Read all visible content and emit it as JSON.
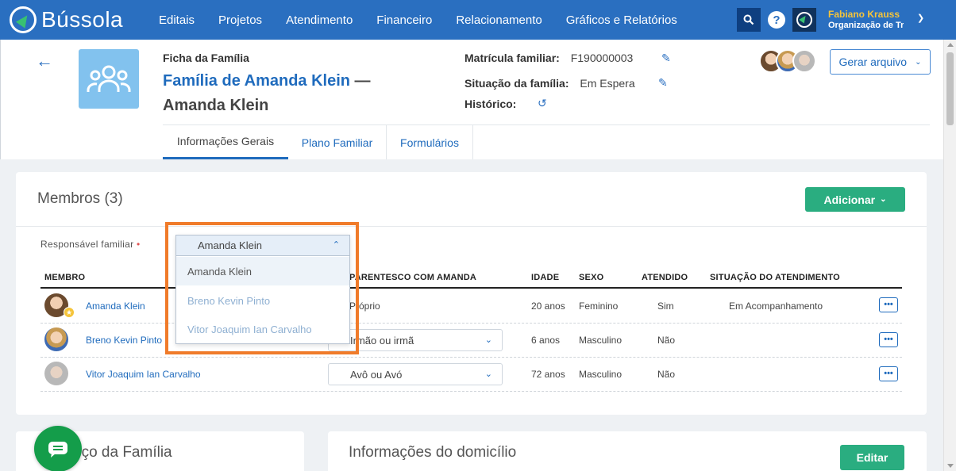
{
  "app": {
    "name": "Bússola"
  },
  "nav": {
    "items": [
      "Editais",
      "Projetos",
      "Atendimento",
      "Financeiro",
      "Relacionamento",
      "Gráficos e Relatórios"
    ]
  },
  "user": {
    "name": "Fabiano Krauss",
    "org": "Organização de Tre"
  },
  "header": {
    "ficha_label": "Ficha da Família",
    "title_link": "Família de Amanda Klein",
    "title_sep": " — ",
    "title_rest": "Amanda Klein",
    "matricula_label": "Matrícula familiar:",
    "matricula_value": "F190000003",
    "situacao_label": "Situação da família:",
    "situacao_value": "Em Espera",
    "historico_label": "Histórico:",
    "gerar_label": "Gerar arquivo"
  },
  "tabs": [
    "Informações Gerais",
    "Plano Familiar",
    "Formulários"
  ],
  "members": {
    "title": "Membros (3)",
    "add_label": "Adicionar",
    "responsavel_label": "Responsável familiar",
    "required_mark": "•",
    "columns": [
      "MEMBRO",
      "PARENTESCO COM AMANDA",
      "IDADE",
      "SEXO",
      "ATENDIDO",
      "SITUAÇÃO DO ATENDIMENTO"
    ],
    "rows": [
      {
        "name": "Amanda Klein",
        "relation": "Próprio",
        "age": "20 anos",
        "sex": "Feminino",
        "attended": "Sim",
        "status": "Em Acompanhamento"
      },
      {
        "name": "Breno Kevin Pinto",
        "relation": "Irmão ou irmã",
        "age": "6 anos",
        "sex": "Masculino",
        "attended": "Não",
        "status": ""
      },
      {
        "name": "Vitor Joaquim Ian Carvalho",
        "relation": "Avô ou Avó",
        "age": "72 anos",
        "sex": "Masculino",
        "attended": "Não",
        "status": ""
      }
    ],
    "more_label": "•••"
  },
  "dropdown": {
    "selected": "Amanda Klein",
    "options": [
      "Amanda Klein",
      "Breno Kevin Pinto",
      "Vitor Joaquim Ian Carvalho"
    ]
  },
  "address_card": {
    "title": "Endereço da Família",
    "visible_title": "eço da Família"
  },
  "domicilio_card": {
    "title": "Informações do domicílio",
    "edit_label": "Editar"
  },
  "colors": {
    "primary": "#2a6fc0",
    "accent_green": "#2aad80",
    "highlight": "#f07b2a",
    "user_name": "#f5c43a"
  }
}
